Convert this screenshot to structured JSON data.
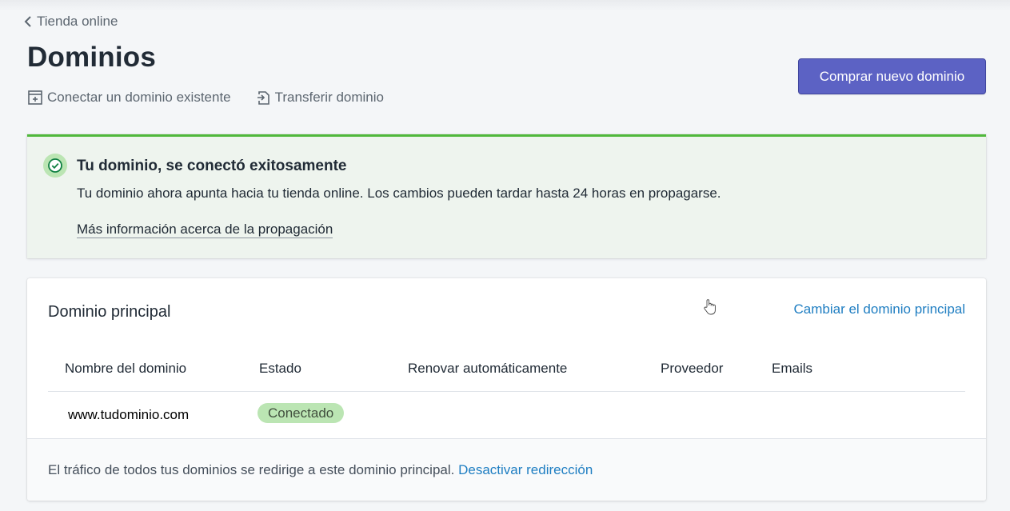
{
  "breadcrumb": {
    "label": "Tienda online"
  },
  "page": {
    "title": "Dominios"
  },
  "secondary_actions": {
    "connect_label": "Conectar un dominio existente",
    "transfer_label": "Transferir dominio"
  },
  "primary_action": {
    "label": "Comprar nuevo dominio"
  },
  "banner": {
    "title": "Tu dominio, se conectó exitosamente",
    "message": "Tu dominio ahora apunta hacia tu tienda online. Los cambios pueden tardar hasta 24 horas en propagarse.",
    "link": "Más información acerca de la propagación",
    "icon": "check-circle-icon",
    "accent_color": "#50b83c"
  },
  "primary_domain_card": {
    "title": "Dominio principal",
    "action": "Cambiar el dominio principal",
    "columns": [
      "Nombre del dominio",
      "Estado",
      "Renovar automáticamente",
      "Proveedor",
      "Emails"
    ],
    "rows": [
      {
        "domain": "www.tudominio.com",
        "status": "Conectado",
        "renew": "",
        "provider": "",
        "emails": ""
      }
    ],
    "footer_text": "El tráfico de todos tus dominios se redirige a este dominio principal.",
    "footer_link": "Desactivar redirección"
  },
  "colors": {
    "primary_button": "#5c62c4",
    "link": "#1f7ec2",
    "badge_success": "#bbe5b3"
  }
}
